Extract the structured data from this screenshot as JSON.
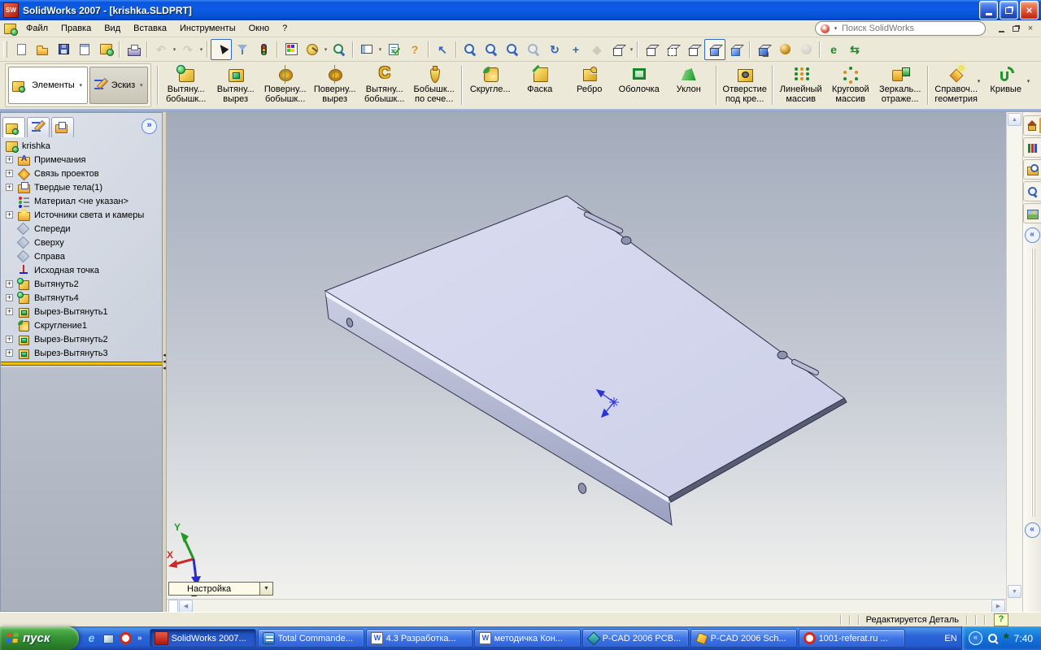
{
  "window": {
    "title": "SolidWorks 2007 - [krishka.SLDPRT]"
  },
  "menu": {
    "items": [
      "Файл",
      "Правка",
      "Вид",
      "Вставка",
      "Инструменты",
      "Окно",
      "?"
    ],
    "search_placeholder": "Поиск SolidWorks"
  },
  "toolbar": {
    "groups": [
      [
        {
          "name": "new-document",
          "kind": "page"
        },
        {
          "name": "open-document",
          "kind": "folder"
        },
        {
          "name": "save",
          "kind": "floppy"
        },
        {
          "name": "make-drawing-from-part",
          "kind": "sheet"
        },
        {
          "name": "make-assembly-from-part",
          "kind": "swpart"
        }
      ],
      [
        {
          "name": "print",
          "kind": "print"
        }
      ],
      [
        {
          "name": "undo",
          "kind": "glyph",
          "glyph": "↶",
          "color": "#a8a48e",
          "grayed": true,
          "dropdown": true
        },
        {
          "name": "redo",
          "kind": "glyph",
          "glyph": "↷",
          "color": "#a8a48e",
          "grayed": true,
          "dropdown": true
        }
      ],
      [
        {
          "name": "select",
          "kind": "cursor",
          "pressed": true
        },
        {
          "name": "selection-filter",
          "kind": "funnel"
        },
        {
          "name": "rebuild",
          "kind": "traffic"
        }
      ],
      [
        {
          "name": "edit-color",
          "kind": "palette"
        },
        {
          "name": "measure",
          "kind": "measure",
          "dropdown": true
        },
        {
          "name": "check",
          "kind": "mag2"
        }
      ],
      [
        {
          "name": "view-settings",
          "kind": "pane",
          "dropdown": true
        },
        {
          "name": "options",
          "kind": "options"
        },
        {
          "name": "help",
          "kind": "glyph",
          "glyph": "?",
          "color": "#e09018"
        }
      ],
      [
        {
          "name": "previous-view",
          "kind": "glyph",
          "glyph": "↖",
          "color": "#3565b5"
        }
      ],
      [
        {
          "name": "zoom-to-fit",
          "kind": "mag"
        },
        {
          "name": "zoom-to-area",
          "kind": "mag"
        },
        {
          "name": "zoom-in-out",
          "kind": "mag"
        },
        {
          "name": "zoom-to-selection",
          "kind": "mag",
          "grayed": true
        },
        {
          "name": "rotate-view",
          "kind": "glyph",
          "glyph": "↻",
          "color": "#3565b5"
        },
        {
          "name": "pan",
          "kind": "glyph",
          "glyph": "+",
          "color": "#3565b5"
        },
        {
          "name": "3d-drawing-view",
          "kind": "glyph",
          "glyph": "◈",
          "color": "#9a9a8a",
          "grayed": true
        },
        {
          "name": "view-orientation",
          "kind": "cube",
          "dropdown": true
        }
      ],
      [
        {
          "name": "wireframe",
          "kind": "cube"
        },
        {
          "name": "hidden-lines-visible",
          "kind": "cubehlv"
        },
        {
          "name": "hidden-lines-removed",
          "kind": "cube"
        },
        {
          "name": "shaded-with-edges",
          "kind": "cubesh",
          "pressed": true
        },
        {
          "name": "shaded",
          "kind": "cubeshf"
        }
      ],
      [
        {
          "name": "shadows-in-shaded-mode",
          "kind": "cubeshadow"
        },
        {
          "name": "realview",
          "kind": "realview"
        },
        {
          "name": "apply-scene",
          "kind": "scene",
          "grayed": true
        }
      ],
      [
        {
          "name": "instant3d",
          "kind": "glyph",
          "glyph": "e",
          "color": "#1a8a2a"
        },
        {
          "name": "physical-dynamics",
          "kind": "glyph",
          "glyph": "⇆",
          "color": "#1a8a2a"
        }
      ]
    ]
  },
  "commandmanager": {
    "tabs": [
      {
        "label": "Элементы",
        "active": true
      },
      {
        "label": "Эскиз",
        "active": false
      }
    ],
    "buttons": [
      {
        "name": "extruded-boss",
        "icon": "boss",
        "line1": "Вытяну...",
        "line2": "бобышк..."
      },
      {
        "name": "extruded-cut",
        "icon": "cut",
        "line1": "Вытяну...",
        "line2": "вырез"
      },
      {
        "name": "revolved-boss",
        "icon": "revboss",
        "line1": "Поверну...",
        "line2": "бобышк..."
      },
      {
        "name": "revolved-cut",
        "icon": "revcut",
        "line1": "Поверну...",
        "line2": "вырез"
      },
      {
        "name": "swept-boss",
        "icon": "sweep",
        "line1": "Вытяну...",
        "line2": "бобышк..."
      },
      {
        "name": "lofted-boss",
        "icon": "loft",
        "line1": "Бобышк...",
        "line2": "по сече..."
      },
      {
        "sep": true
      },
      {
        "name": "fillet",
        "icon": "fillet",
        "line1": "Скругле...",
        "line2": ""
      },
      {
        "name": "chamfer",
        "icon": "chamfer",
        "line1": "Фаска",
        "line2": ""
      },
      {
        "name": "rib",
        "icon": "rib",
        "line1": "Ребро",
        "line2": ""
      },
      {
        "name": "shell",
        "icon": "shell",
        "line1": "Оболочка",
        "line2": ""
      },
      {
        "name": "draft",
        "icon": "draft",
        "line1": "Уклон",
        "line2": ""
      },
      {
        "sep": true
      },
      {
        "name": "hole-wizard",
        "icon": "hole",
        "line1": "Отверстие",
        "line2": "под кре..."
      },
      {
        "sep": true
      },
      {
        "name": "linear-pattern",
        "icon": "linpat",
        "line1": "Линейный",
        "line2": "массив"
      },
      {
        "name": "circular-pattern",
        "icon": "circpat",
        "line1": "Круговой",
        "line2": "массив"
      },
      {
        "name": "mirror",
        "icon": "mirror",
        "line1": "Зеркаль...",
        "line2": "отраже..."
      },
      {
        "sep": true
      },
      {
        "name": "reference-geometry",
        "icon": "refgeom",
        "line1": "Справоч...",
        "line2": "геометрия",
        "dropdown": true
      },
      {
        "name": "curves",
        "icon": "curves",
        "line1": "Кривые",
        "line2": "",
        "dropdown": true
      }
    ]
  },
  "featuretree": {
    "root": "krishka",
    "plus_glyph": "+",
    "items": [
      {
        "label": "Примечания",
        "icon": "folder-a",
        "expandable": true
      },
      {
        "label": "Связь проектов",
        "icon": "link-diamond",
        "expandable": true
      },
      {
        "label": "Твердые тела(1)",
        "icon": "folder-cube",
        "expandable": true
      },
      {
        "label": "Материал <не указан>",
        "icon": "material",
        "expandable": false
      },
      {
        "label": "Источники света и камеры",
        "icon": "folder-light",
        "expandable": true
      },
      {
        "label": "Спереди",
        "icon": "plane",
        "expandable": false
      },
      {
        "label": "Сверху",
        "icon": "plane",
        "expandable": false
      },
      {
        "label": "Справа",
        "icon": "plane",
        "expandable": false
      },
      {
        "label": "Исходная точка",
        "icon": "origin",
        "expandable": false
      },
      {
        "label": "Вытянуть2",
        "icon": "boss",
        "expandable": true
      },
      {
        "label": "Вытянуть4",
        "icon": "boss",
        "expandable": true
      },
      {
        "label": "Вырез-Вытянуть1",
        "icon": "cut",
        "expandable": true
      },
      {
        "label": "Скругление1",
        "icon": "fillet",
        "expandable": false
      },
      {
        "label": "Вырез-Вытянуть2",
        "icon": "cut",
        "expandable": true
      },
      {
        "label": "Вырез-Вытянуть3",
        "icon": "cut",
        "expandable": true
      }
    ]
  },
  "viewport": {
    "combo_label": "Настройка",
    "triad": {
      "x": "X",
      "y": "Y",
      "z": "Z"
    }
  },
  "taskpane": {
    "tabs": [
      {
        "name": "solidworks-resources",
        "icon": "home",
        "active": true
      },
      {
        "name": "design-library",
        "icon": "lib",
        "active": false
      },
      {
        "name": "file-explorer",
        "icon": "expl",
        "active": false
      },
      {
        "name": "search",
        "icon": "search",
        "active": false
      },
      {
        "name": "view-palette",
        "icon": "pal",
        "active": false
      }
    ],
    "collapse_glyph": "«"
  },
  "statusbar": {
    "text": "Редактируется Деталь",
    "help_glyph": "?"
  },
  "taskbar": {
    "start_label": "пуск",
    "quick_launch": [
      {
        "name": "internet-explorer",
        "icon": "ie",
        "glyph": "e"
      },
      {
        "name": "show-desktop",
        "icon": "desk"
      },
      {
        "name": "opera",
        "icon": "opera"
      }
    ],
    "more_glyph": "»",
    "tasks": [
      {
        "label": "SolidWorks 2007...",
        "icon": "sw",
        "active": true
      },
      {
        "label": "Total Commande...",
        "icon": "tc",
        "active": false
      },
      {
        "label": "4.3 Разработка...",
        "icon": "word",
        "active": false
      },
      {
        "label": "методичка Кон...",
        "icon": "word",
        "active": false
      },
      {
        "label": "P-CAD 2006 PCB...",
        "icon": "pcad1",
        "active": false
      },
      {
        "label": "P-CAD 2006 Sch...",
        "icon": "pcad2",
        "active": false
      },
      {
        "label": "1001-referat.ru ...",
        "icon": "opera",
        "active": false
      }
    ],
    "lang": "EN",
    "time": "7:40"
  }
}
